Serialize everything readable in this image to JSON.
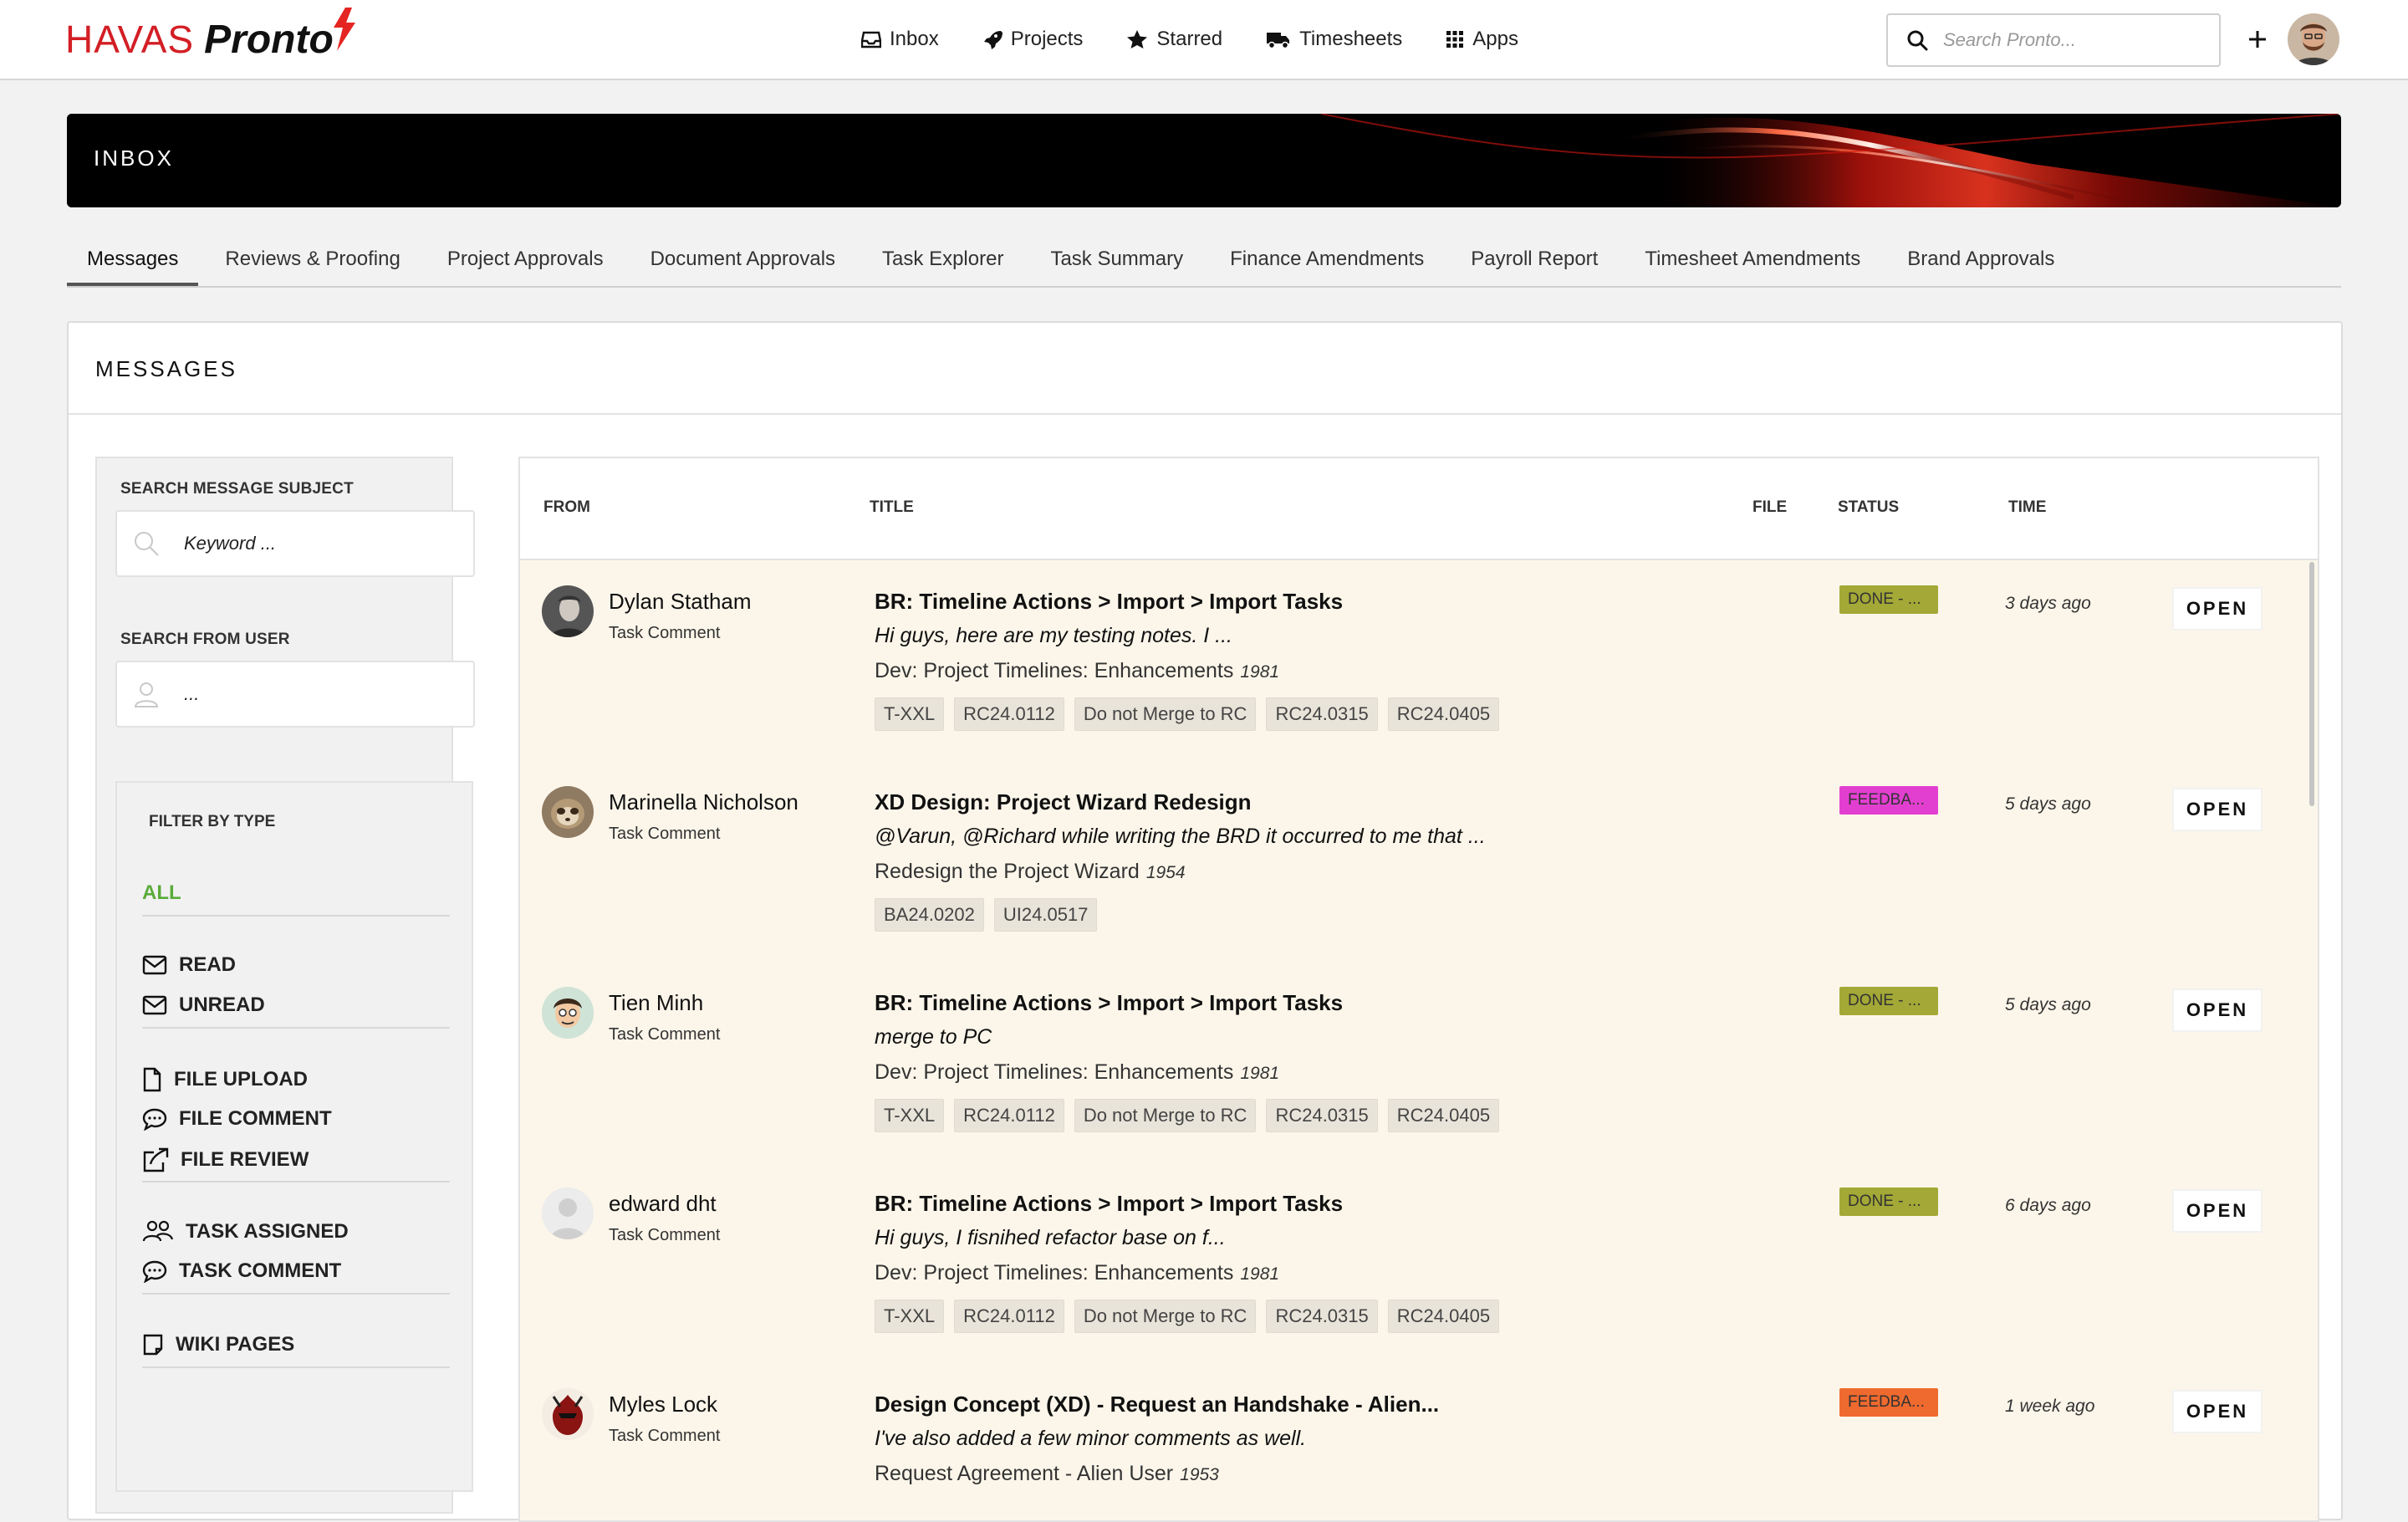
{
  "brand": {
    "havas": "HAVAS",
    "pronto": "Pronto"
  },
  "nav": [
    {
      "label": "Inbox",
      "icon": "inbox-icon"
    },
    {
      "label": "Projects",
      "icon": "rocket-icon"
    },
    {
      "label": "Starred",
      "icon": "star-icon"
    },
    {
      "label": "Timesheets",
      "icon": "truck-icon"
    },
    {
      "label": "Apps",
      "icon": "grid-icon"
    }
  ],
  "search": {
    "placeholder": "Search Pronto..."
  },
  "banner": {
    "title": "INBOX"
  },
  "tabs": [
    {
      "label": "Messages",
      "active": true
    },
    {
      "label": "Reviews & Proofing"
    },
    {
      "label": "Project Approvals"
    },
    {
      "label": "Document Approvals"
    },
    {
      "label": "Task Explorer"
    },
    {
      "label": "Task Summary"
    },
    {
      "label": "Finance Amendments"
    },
    {
      "label": "Payroll Report"
    },
    {
      "label": "Timesheet Amendments"
    },
    {
      "label": "Brand Approvals"
    }
  ],
  "panel": {
    "title": "MESSAGES"
  },
  "filters": {
    "subject_label": "SEARCH MESSAGE SUBJECT",
    "subject_placeholder": "Keyword ...",
    "user_label": "SEARCH FROM USER",
    "user_placeholder": "...",
    "type_label": "FILTER BY TYPE",
    "all": "ALL",
    "read": "READ",
    "unread": "UNREAD",
    "file_upload": "FILE UPLOAD",
    "file_comment": "FILE COMMENT",
    "file_review": "FILE REVIEW",
    "task_assigned": "TASK ASSIGNED",
    "task_comment": "TASK COMMENT",
    "wiki_pages": "WIKI PAGES"
  },
  "table": {
    "headers": {
      "from": "FROM",
      "title": "TITLE",
      "file": "FILE",
      "status": "STATUS",
      "time": "TIME"
    },
    "open_label": "OPEN",
    "rows": [
      {
        "from": "Dylan Statham",
        "type": "Task Comment",
        "title": "BR: Timeline Actions > Import > Import Tasks",
        "snippet": "Hi guys, here are my testing notes. I ...",
        "project": "Dev: Project Timelines: Enhancements",
        "project_id": "1981",
        "tags": [
          "T-XXL",
          "RC24.0112",
          "Do not Merge to RC",
          "RC24.0315",
          "RC24.0405"
        ],
        "status": "DONE - ...",
        "status_color": "#a3a836",
        "time": "3 days ago"
      },
      {
        "from": "Marinella Nicholson",
        "type": "Task Comment",
        "title": "XD Design: Project Wizard Redesign",
        "snippet": "@Varun, @Richard while writing the BRD it occurred to me that ...",
        "project": "Redesign the Project Wizard",
        "project_id": "1954",
        "tags": [
          "BA24.0202",
          "UI24.0517"
        ],
        "status": "FEEDBA...",
        "status_color": "#e23fd0",
        "time": "5 days ago"
      },
      {
        "from": "Tien Minh",
        "type": "Task Comment",
        "title": "BR: Timeline Actions > Import > Import Tasks",
        "snippet": "merge to PC",
        "project": "Dev: Project Timelines: Enhancements",
        "project_id": "1981",
        "tags": [
          "T-XXL",
          "RC24.0112",
          "Do not Merge to RC",
          "RC24.0315",
          "RC24.0405"
        ],
        "status": "DONE - ...",
        "status_color": "#a3a836",
        "time": "5 days ago"
      },
      {
        "from": "edward dht",
        "type": "Task Comment",
        "title": "BR: Timeline Actions > Import > Import Tasks",
        "snippet": "Hi guys, I fisnihed refactor base on f...",
        "project": "Dev: Project Timelines: Enhancements",
        "project_id": "1981",
        "tags": [
          "T-XXL",
          "RC24.0112",
          "Do not Merge to RC",
          "RC24.0315",
          "RC24.0405"
        ],
        "status": "DONE - ...",
        "status_color": "#a3a836",
        "time": "6 days ago"
      },
      {
        "from": "Myles Lock",
        "type": "Task Comment",
        "title": "Design Concept (XD) - Request an Handshake - Alien...",
        "snippet": "I've also added a few minor comments as well.",
        "project": "Request Agreement - Alien User",
        "project_id": "1953",
        "tags": [],
        "status": "FEEDBA...",
        "status_color": "#ef6a2e",
        "time": "1 week ago"
      }
    ]
  }
}
